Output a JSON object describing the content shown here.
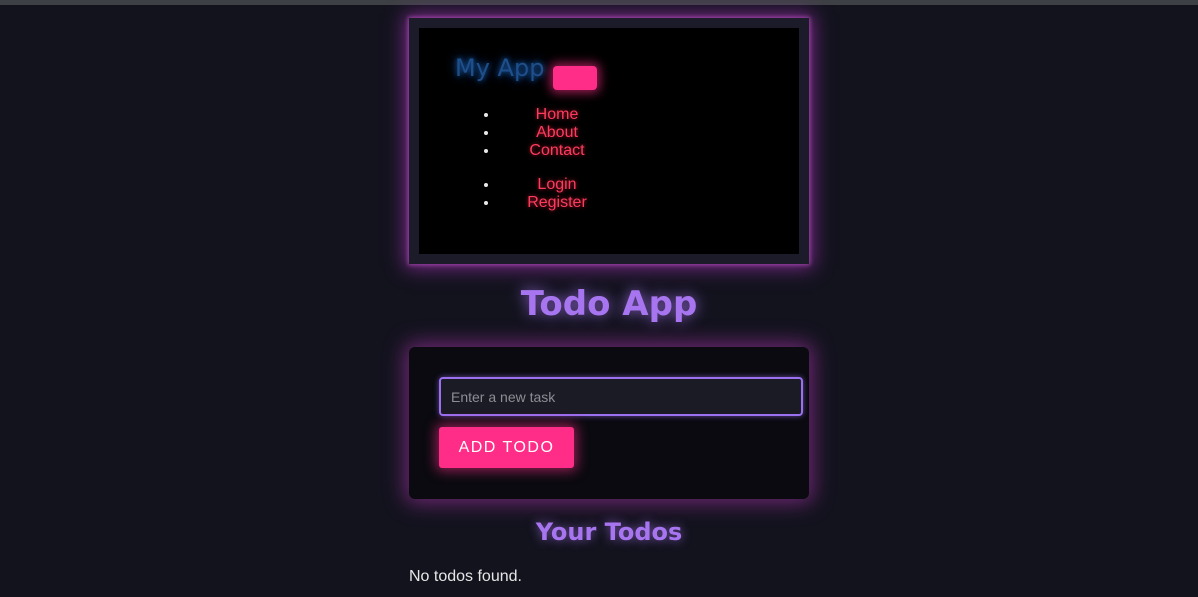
{
  "navbar": {
    "brand": "My App",
    "primary_links": [
      "Home",
      "About",
      "Contact"
    ],
    "auth_links": [
      "Login",
      "Register"
    ]
  },
  "title": "Todo App",
  "form": {
    "input_placeholder": "Enter a new task",
    "input_value": "",
    "add_button": "ADD TODO"
  },
  "todos": {
    "heading": "Your Todos",
    "empty_message": "No todos found.",
    "items": []
  },
  "colors": {
    "accent_pink": "#ff2d87",
    "accent_purple": "#a875f0",
    "link_red": "#ff3b5c",
    "brand_blue": "#1f4f8a",
    "background": "#13131e"
  }
}
